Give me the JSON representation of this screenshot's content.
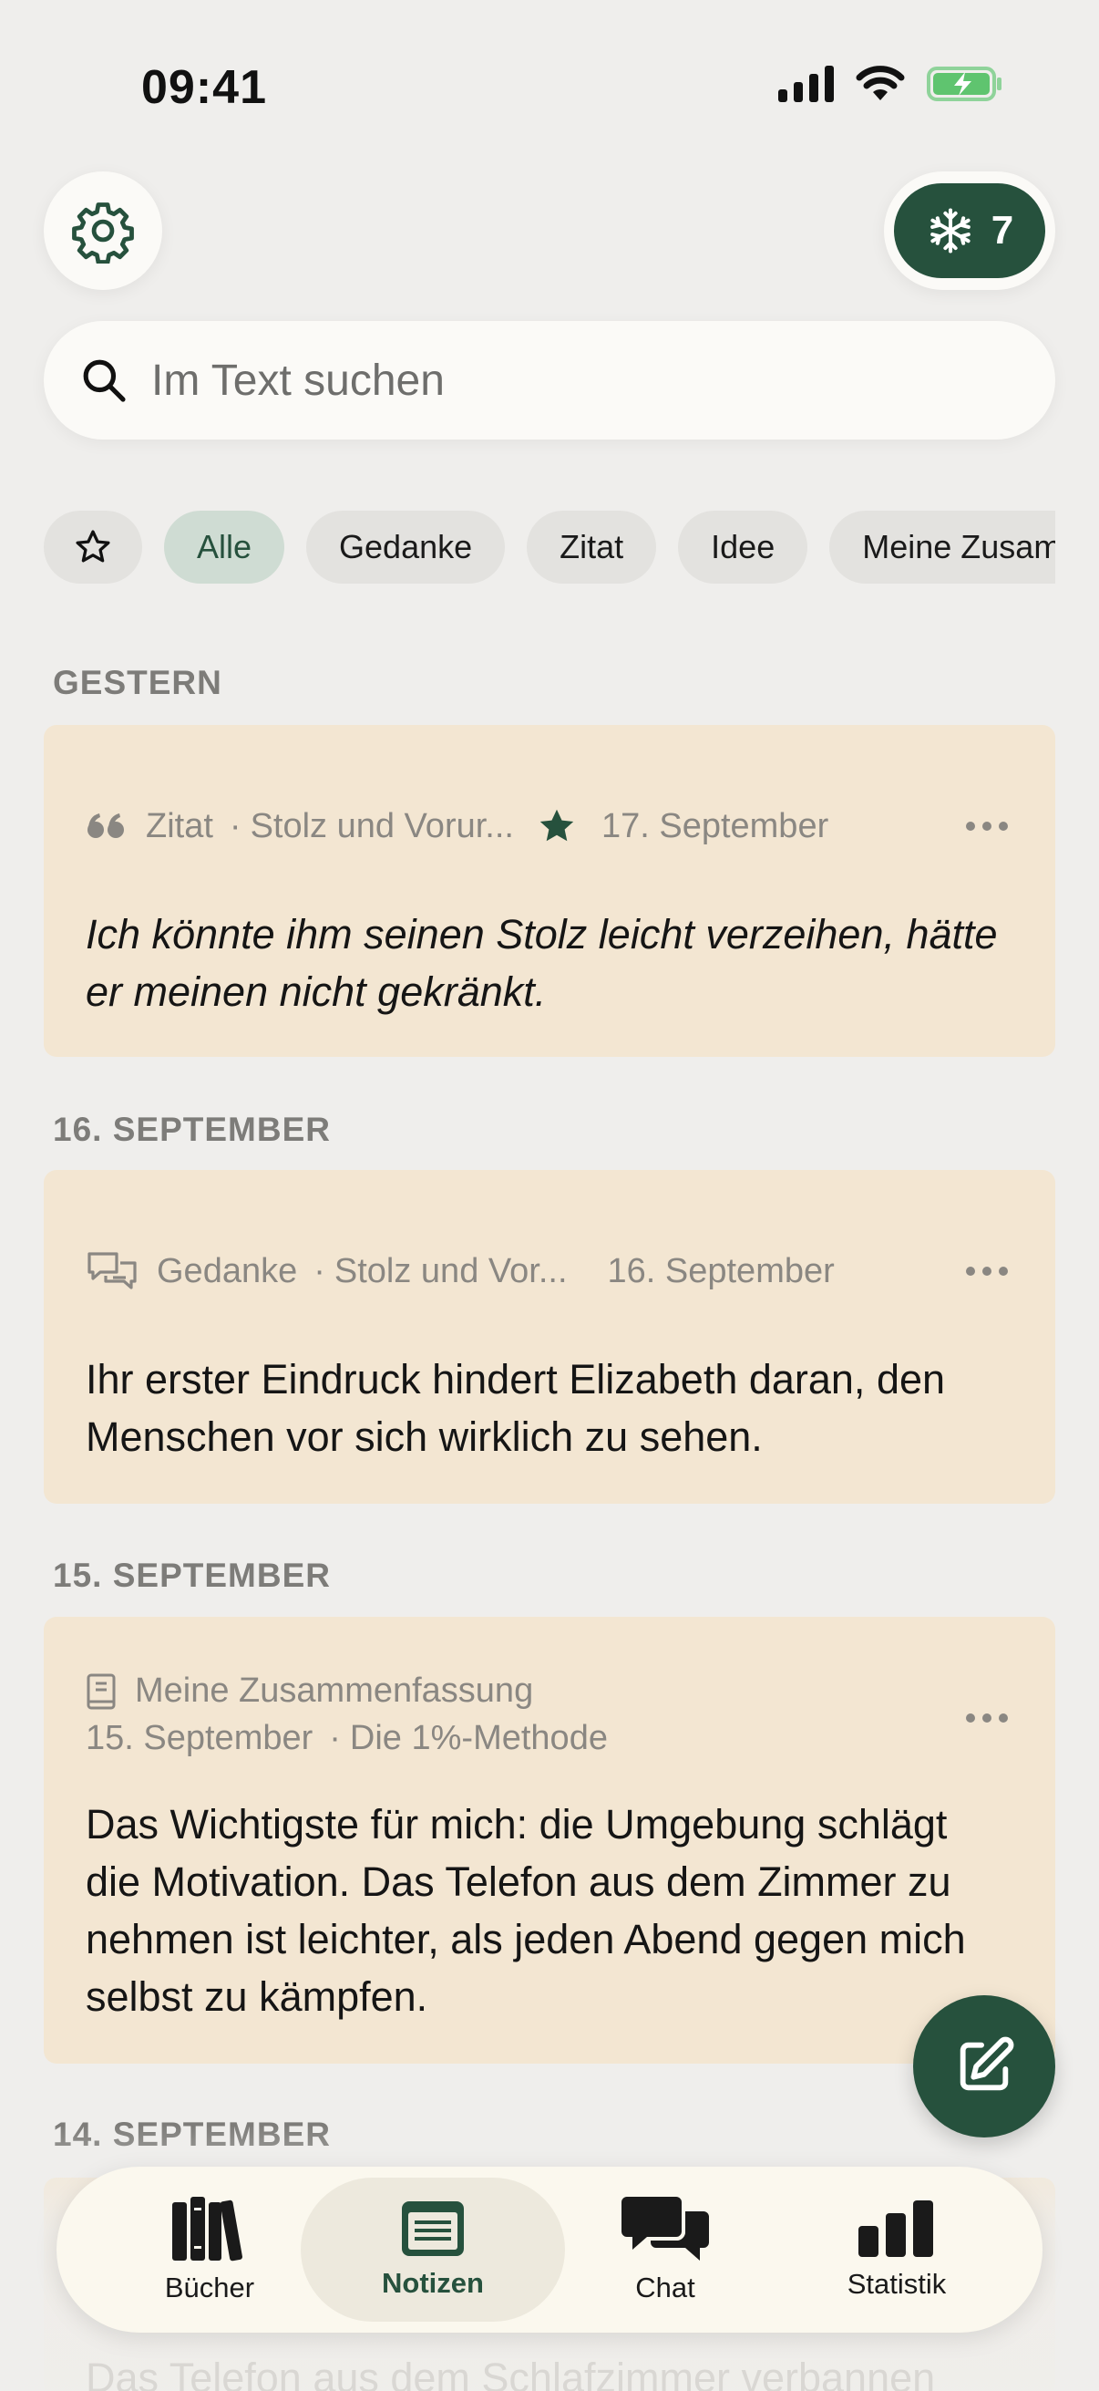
{
  "status_bar": {
    "time": "09:41"
  },
  "header": {
    "streak_count": "7"
  },
  "search": {
    "placeholder": "Im Text suchen"
  },
  "filters": {
    "chips": [
      "Alle",
      "Gedanke",
      "Zitat",
      "Idee",
      "Meine Zusammenfassung"
    ],
    "active": "Alle"
  },
  "sections": [
    {
      "label": "GESTERN",
      "note": {
        "type": "Zitat",
        "book": "Stolz und Vorur...",
        "favorite": true,
        "date": "17. September",
        "text": "Ich könnte ihm seinen Stolz leicht verzeihen, hätte er meinen nicht gekränkt."
      }
    },
    {
      "label": "16. SEPTEMBER",
      "note": {
        "type": "Gedanke",
        "book": "Stolz und Vor...",
        "date": "16. September",
        "text": "Ihr erster Eindruck hindert Elizabeth daran, den Menschen vor sich wirklich zu sehen."
      }
    },
    {
      "label": "15. SEPTEMBER",
      "note": {
        "type": "Meine Zusammenfassung",
        "date": "15. September",
        "book": "Die 1%-Methode",
        "text": "Das Wichtigste für mich: die Umgebung schlägt die Motivation. Das Telefon aus dem Zimmer zu nehmen ist leichter, als jeden Abend gegen mich selbst zu kämpfen."
      }
    },
    {
      "label": "14. SEPTEMBER",
      "note": {
        "text": "Das Telefon aus dem Schlafzimmer verbannen"
      }
    }
  ],
  "tabbar": {
    "tabs": [
      "Bücher",
      "Notizen",
      "Chat",
      "Statistik"
    ],
    "active": "Notizen"
  },
  "colors": {
    "accent": "#26513d",
    "card": "#f3e6d2",
    "background": "#efeeec"
  },
  "icons": [
    "gear-icon",
    "snowflake-icon",
    "search-icon",
    "star-icon",
    "quote-icon",
    "chat-bubbles-icon",
    "book-icon",
    "more-icon",
    "compose-icon",
    "books-icon",
    "notes-icon",
    "chat-icon",
    "stats-icon"
  ]
}
